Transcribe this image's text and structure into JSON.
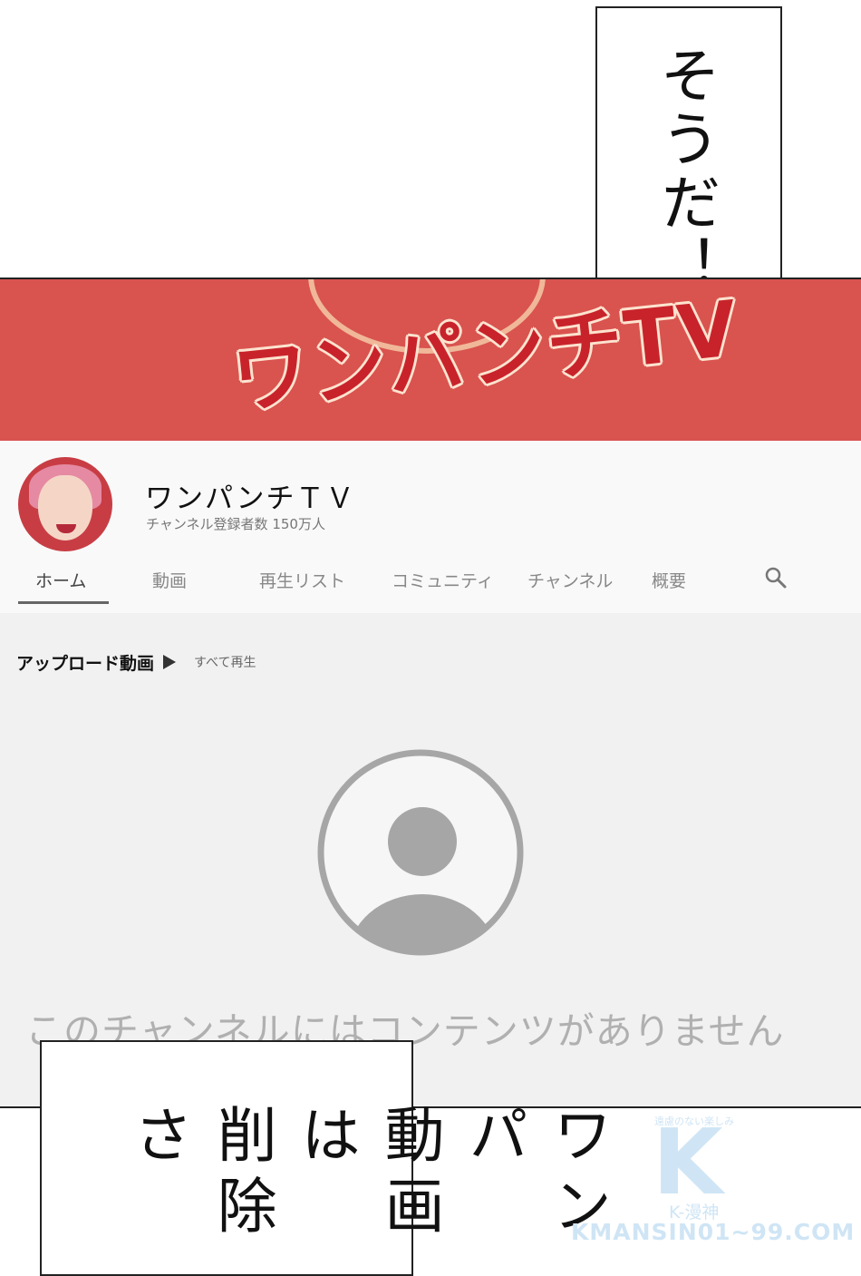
{
  "bubble_top": {
    "text": "そうだ！"
  },
  "channel": {
    "banner_logo": "ワンパンチTV",
    "name": "ワンパンチＴＶ",
    "subscribers": "チャンネル登録者数 150万人"
  },
  "tabs": [
    {
      "label": "ホーム",
      "active": true
    },
    {
      "label": "動画"
    },
    {
      "label": "再生リスト"
    },
    {
      "label": "コミュニティ"
    },
    {
      "label": "チャンネル"
    },
    {
      "label": "概要"
    }
  ],
  "section": {
    "title": "アップロード動画",
    "play_all": "すべて再生"
  },
  "empty_state": {
    "message": "このチャンネルにはコンテンツがありません"
  },
  "bubble_bottom": {
    "lines": [
      "ワンパ",
      "動画は",
      "削除さ"
    ]
  },
  "watermark": {
    "top": "遠慮のない楽しみ",
    "letter": "K",
    "middle": "K-漫神",
    "url": "KMANSIN01~99.COM"
  },
  "colors": {
    "banner": "#d9534f",
    "logo": "#c8232b",
    "panel_bg": "#f1f1f1",
    "empty_icon": "#a6a6a6",
    "watermark": "#cfe5f5"
  },
  "icons": [
    "search-icon",
    "play-icon",
    "default-avatar-icon"
  ]
}
